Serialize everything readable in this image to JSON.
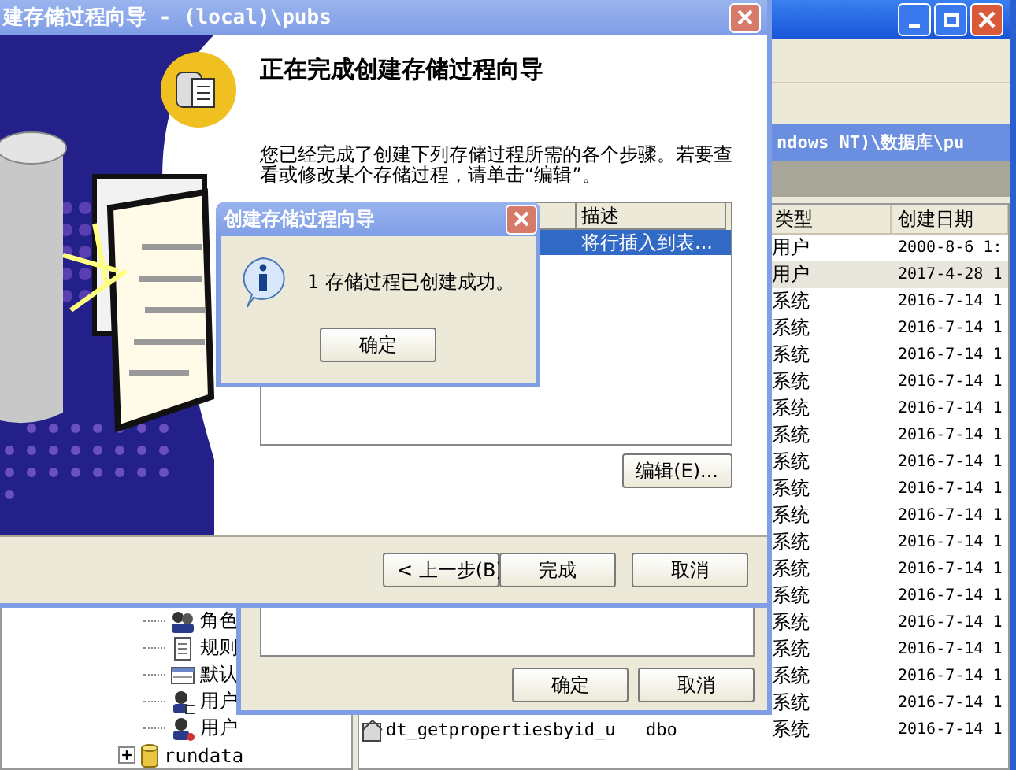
{
  "main_window": {
    "path": "ndows NT)\\数据库\\pu",
    "tree": [
      {
        "label": "角色",
        "kind": "roles"
      },
      {
        "label": "规则",
        "kind": "rules"
      },
      {
        "label": "默认",
        "kind": "defaults"
      },
      {
        "label": "用户",
        "kind": "users"
      },
      {
        "label": "用户",
        "kind": "user-types"
      }
    ],
    "tree_root": {
      "label": "rundata",
      "expanded": false
    },
    "list": {
      "columns": [
        "类型",
        "创建日期"
      ],
      "rows": [
        {
          "type": "用户",
          "created": "2000-8-6 1:",
          "selected": false
        },
        {
          "type": "用户",
          "created": "2017-4-28 1",
          "selected": true
        },
        {
          "type": "系统",
          "created": "2016-7-14 1",
          "selected": false
        },
        {
          "type": "系统",
          "created": "2016-7-14 1",
          "selected": false
        },
        {
          "type": "系统",
          "created": "2016-7-14 1",
          "selected": false
        },
        {
          "type": "系统",
          "created": "2016-7-14 1",
          "selected": false
        },
        {
          "type": "系统",
          "created": "2016-7-14 1",
          "selected": false
        },
        {
          "type": "系统",
          "created": "2016-7-14 1",
          "selected": false
        },
        {
          "type": "系统",
          "created": "2016-7-14 1",
          "selected": false
        },
        {
          "type": "系统",
          "created": "2016-7-14 1",
          "selected": false
        },
        {
          "type": "系统",
          "created": "2016-7-14 1",
          "selected": false
        },
        {
          "type": "系统",
          "created": "2016-7-14 1",
          "selected": false
        },
        {
          "type": "系统",
          "created": "2016-7-14 1",
          "selected": false
        },
        {
          "type": "系统",
          "created": "2016-7-14 1",
          "selected": false
        },
        {
          "type": "系统",
          "created": "2016-7-14 1",
          "selected": false
        },
        {
          "type": "系统",
          "created": "2016-7-14 1",
          "selected": false
        },
        {
          "type": "系统",
          "created": "2016-7-14 1",
          "selected": false
        },
        {
          "type": "系统",
          "created": "2016-7-14 1",
          "selected": false
        },
        {
          "name": "dt_getpropertiesbyid_u",
          "owner": "dbo",
          "type": "系统",
          "created": "2016-7-14 1",
          "selected": false
        }
      ]
    }
  },
  "behind_dialog": {
    "buttons": [
      "确定",
      "取消"
    ]
  },
  "wizard": {
    "title": "建存储过程向导 - (local)\\pubs",
    "heading": "正在完成创建存储过程向导",
    "description": "您已经完成了创建下列存储过程所需的各个步骤。若要查看或修改某个存储过程，请单击“编辑”。",
    "list": {
      "columns": [
        "描述"
      ],
      "rows": [
        {
          "description": "将行插入到表...",
          "selected": true
        }
      ]
    },
    "edit_button": "编辑(E)...",
    "buttons": [
      "< 上一步(B)",
      "完成",
      "取消"
    ]
  },
  "message_box": {
    "title": "创建存储过程向导",
    "message": "1 存储过程已创建成功。",
    "button": "确定"
  }
}
